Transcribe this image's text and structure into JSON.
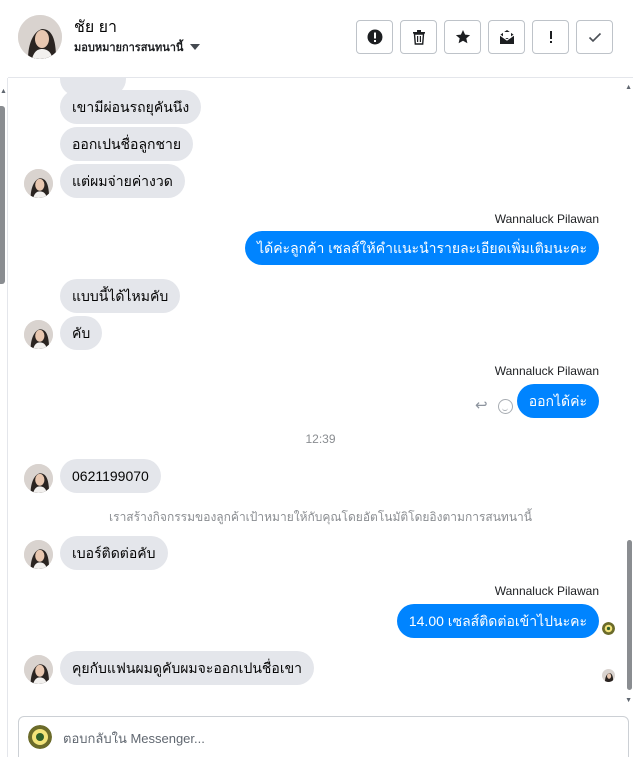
{
  "header": {
    "contact_name": "ชัย ยา",
    "assign_label": "มอบหมายการสนทนานี้",
    "actions": [
      {
        "name": "report-button",
        "icon": "alert-circle-icon"
      },
      {
        "name": "delete-button",
        "icon": "trash-icon"
      },
      {
        "name": "star-button",
        "icon": "star-icon"
      },
      {
        "name": "mark-unread-button",
        "icon": "envelope-icon"
      },
      {
        "name": "follow-up-button",
        "icon": "exclamation-icon"
      },
      {
        "name": "mark-done-button",
        "icon": "check-icon"
      }
    ]
  },
  "messages": {
    "in_1": "เขามีผ่อนรถยุคันนึง",
    "in_2": "ออกเปนชื่อลูกชาย",
    "in_3": "แต่ผมจ่ายค่างวด",
    "agent_1": "Wannaluck Pilawan",
    "out_1": "ได้ค่ะลูกค้า  เซลส์ให้คำแนะนำรายละเอียดเพิ่มเติมนะคะ",
    "in_4": "แบบนี้ได้ไหมคับ",
    "in_5": "คับ",
    "agent_2": "Wannaluck Pilawan",
    "out_2": "ออกได้ค่ะ",
    "time_1": "12:39",
    "in_6": "0621199070",
    "system_1": "เราสร้างกิจกรรมของลูกค้าเป้าหมายให้กับคุณโดยอัตโนมัติโดยอิงตามการสนทนานี้",
    "in_7": "เบอร์ติดต่อคับ",
    "agent_3": "Wannaluck Pilawan",
    "out_3": "14.00  เซลส์ติดต่อเข้าไปนะคะ",
    "in_8": "คุยกับแฟนผมดูคับผมจะออกเปนชื่อเขา"
  },
  "composer": {
    "placeholder": "ตอบกลับใน Messenger..."
  },
  "colors": {
    "outgoing_bubble": "#0084ff",
    "incoming_bubble": "#e4e6eb",
    "muted_text": "#8a8d91"
  }
}
